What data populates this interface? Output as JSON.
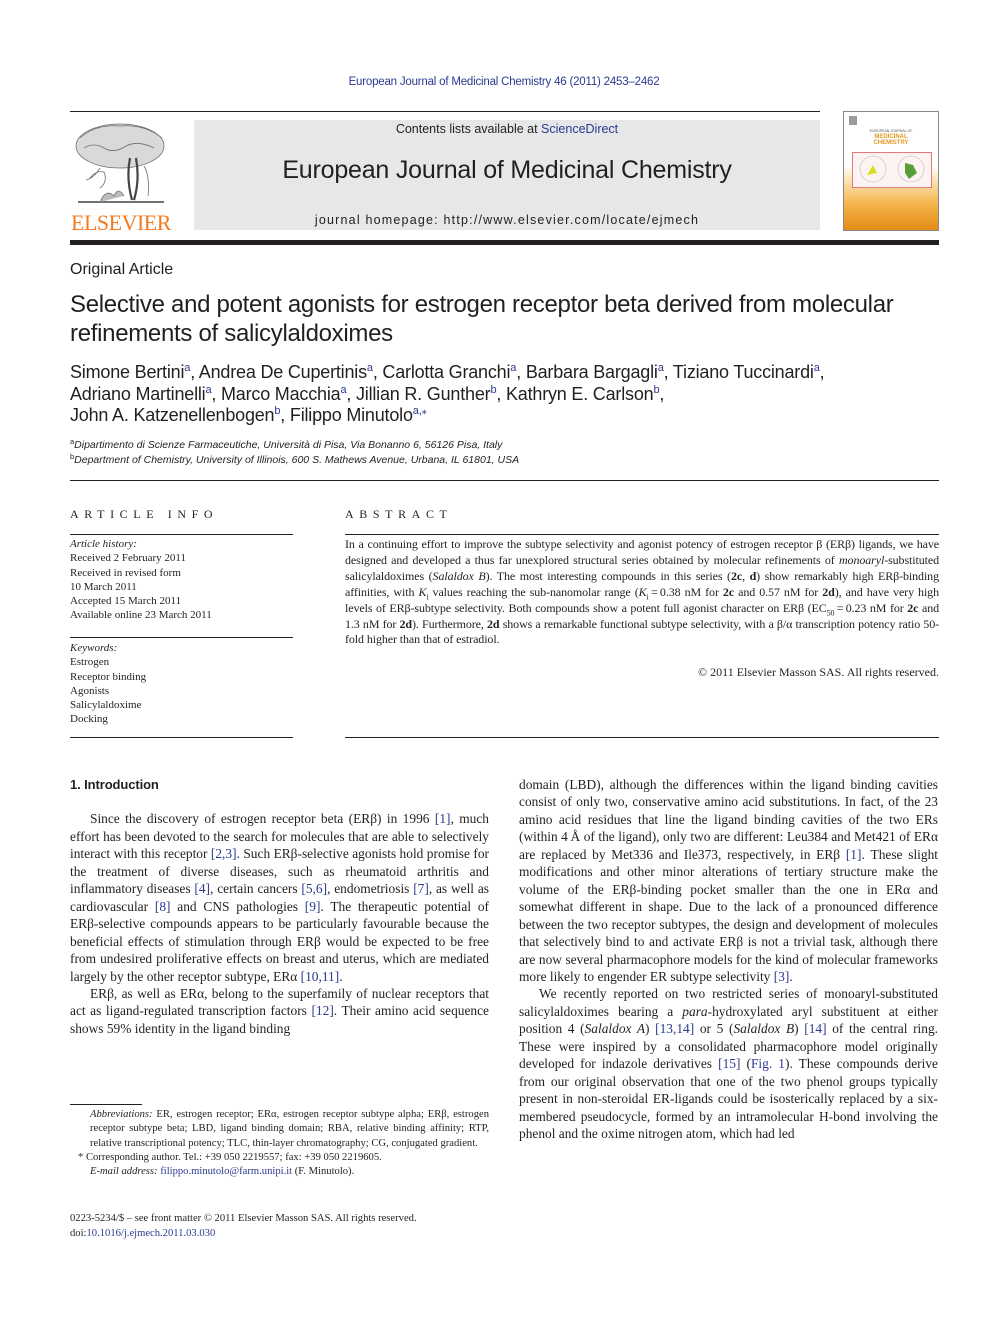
{
  "running_header": "European Journal of Medicinal Chemistry 46 (2011) 2453–2462",
  "masthead": {
    "publisher_logo": "ELSEVIER",
    "contents_prefix": "Contents lists available at ",
    "contents_link": "ScienceDirect",
    "journal_name": "European Journal of Medicinal Chemistry",
    "homepage_label": "journal homepage: ",
    "homepage_url": "http://www.elsevier.com/locate/ejmech",
    "cover_small": "EUROPEAN JOURNAL OF",
    "cover_title_1": "MEDICINAL",
    "cover_title_2": "CHEMISTRY"
  },
  "colors": {
    "link": "#2b3990",
    "elsevier_orange": "#f47920",
    "masthead_bg": "#e6e7e8"
  },
  "article": {
    "type": "Original Article",
    "title": "Selective and potent agonists for estrogen receptor beta derived from molecular refinements of salicylaldoximes",
    "authors": [
      {
        "name": "Simone Bertini",
        "aff": "a"
      },
      {
        "name": "Andrea De Cupertinis",
        "aff": "a"
      },
      {
        "name": "Carlotta Granchi",
        "aff": "a"
      },
      {
        "name": "Barbara Bargagli",
        "aff": "a"
      },
      {
        "name": "Tiziano Tuccinardi",
        "aff": "a",
        "br": true
      },
      {
        "name": "Adriano Martinelli",
        "aff": "a"
      },
      {
        "name": "Marco Macchia",
        "aff": "a"
      },
      {
        "name": "Jillian R. Gunther",
        "aff": "b"
      },
      {
        "name": "Kathryn E. Carlson",
        "aff": "b",
        "br": true
      },
      {
        "name": "John A. Katzenellenbogen",
        "aff": "b"
      },
      {
        "name": "Filippo Minutolo",
        "aff": "a,⁎",
        "last": true
      }
    ],
    "affiliations": [
      {
        "key": "a",
        "text": "Dipartimento di Scienze Farmaceutiche, Università di Pisa, Via Bonanno 6, 56126 Pisa, Italy"
      },
      {
        "key": "b",
        "text": "Department of Chemistry, University of Illinois, 600 S. Mathews Avenue, Urbana, IL 61801, USA"
      }
    ]
  },
  "article_info": {
    "heading": "ARTICLE INFO",
    "history_label": "Article history:",
    "history": [
      "Received 2 February 2011",
      "Received in revised form",
      "10 March 2011",
      "Accepted 15 March 2011",
      "Available online 23 March 2011"
    ],
    "keywords_label": "Keywords:",
    "keywords": [
      "Estrogen",
      "Receptor binding",
      "Agonists",
      "Salicylaldoxime",
      "Docking"
    ]
  },
  "abstract": {
    "heading": "ABSTRACT",
    "runs": [
      {
        "t": "In a continuing effort to improve the subtype selectivity and agonist potency of estrogen receptor β (ERβ) ligands, we have designed and developed a thus far unexplored structural series obtained by molecular refinements of "
      },
      {
        "t": "monoaryl",
        "s": "i"
      },
      {
        "t": "-substituted salicylaldoximes ("
      },
      {
        "t": "Salaldox B",
        "s": "i"
      },
      {
        "t": "). The most interesting compounds in this series ("
      },
      {
        "t": "2c",
        "s": "b"
      },
      {
        "t": ", "
      },
      {
        "t": "d",
        "s": "b"
      },
      {
        "t": ") show remarkably high ERβ-binding affinities, with "
      },
      {
        "t": "K",
        "s": "i"
      },
      {
        "t": "i",
        "s": "sub"
      },
      {
        "t": " values reaching the sub-nanomolar range ("
      },
      {
        "t": "K",
        "s": "i"
      },
      {
        "t": "i",
        "s": "sub"
      },
      {
        "t": " = 0.38 nM for "
      },
      {
        "t": "2c",
        "s": "b"
      },
      {
        "t": " and 0.57 nM for "
      },
      {
        "t": "2d",
        "s": "b"
      },
      {
        "t": "), and have very high levels of ERβ-subtype selectivity. Both compounds show a potent full agonist character on ERβ (EC"
      },
      {
        "t": "50",
        "s": "sub"
      },
      {
        "t": " = 0.23 nM for "
      },
      {
        "t": "2c",
        "s": "b"
      },
      {
        "t": " and 1.3 nM for "
      },
      {
        "t": "2d",
        "s": "b"
      },
      {
        "t": "). Furthermore, "
      },
      {
        "t": "2d",
        "s": "b"
      },
      {
        "t": " shows a remarkable functional subtype selectivity, with a β/α transcription potency ratio 50-fold higher than that of estradiol."
      }
    ],
    "copyright": "© 2011 Elsevier Masson SAS. All rights reserved."
  },
  "body": {
    "section_heading": "1.  Introduction",
    "left_paragraphs": [
      [
        {
          "t": "Since the discovery of estrogen receptor beta (ERβ) in 1996 "
        },
        {
          "t": "[1]",
          "s": "a"
        },
        {
          "t": ", much effort has been devoted to the search for molecules that are able to selectively interact with this receptor "
        },
        {
          "t": "[2,3]",
          "s": "a"
        },
        {
          "t": ". Such ERβ-selective agonists hold promise for the treatment of diverse diseases, such as rheumatoid arthritis and inflammatory diseases "
        },
        {
          "t": "[4]",
          "s": "a"
        },
        {
          "t": ", certain cancers "
        },
        {
          "t": "[5,6]",
          "s": "a"
        },
        {
          "t": ", endometriosis "
        },
        {
          "t": "[7]",
          "s": "a"
        },
        {
          "t": ", as well as cardiovascular "
        },
        {
          "t": "[8]",
          "s": "a"
        },
        {
          "t": " and CNS pathologies "
        },
        {
          "t": "[9]",
          "s": "a"
        },
        {
          "t": ". The therapeutic potential of ERβ-selective compounds appears to be particularly favourable because the beneficial effects of stimulation through ERβ would be expected to be free from undesired proliferative effects on breast and uterus, which are mediated largely by the other receptor subtype, ERα "
        },
        {
          "t": "[10,11]",
          "s": "a"
        },
        {
          "t": "."
        }
      ],
      [
        {
          "t": "ERβ, as well as ERα, belong to the superfamily of nuclear receptors that act as ligand-regulated transcription factors "
        },
        {
          "t": "[12]",
          "s": "a"
        },
        {
          "t": ". Their amino acid sequence shows 59% identity in the ligand binding"
        }
      ]
    ],
    "right_paragraphs": [
      [
        {
          "t": "domain (LBD), although the differences within the ligand binding cavities consist of only two, conservative amino acid substitutions. In fact, of the 23 amino acid residues that line the ligand binding cavities of the two ERs (within 4 Å of the ligand), only two are different: Leu384 and Met421 of ERα are replaced by Met336 and Ile373, respectively, in ERβ "
        },
        {
          "t": "[1]",
          "s": "a"
        },
        {
          "t": ". These slight modifications and other minor alterations of tertiary structure make the volume of the ERβ-binding pocket smaller than the one in ERα and somewhat different in shape. Due to the lack of a pronounced difference between the two receptor subtypes, the design and development of molecules that selectively bind to and activate ERβ is not a trivial task, although there are now several pharmacophore models for the kind of molecular frameworks more likely to engender ER subtype selectivity "
        },
        {
          "t": "[3]",
          "s": "a"
        },
        {
          "t": "."
        }
      ],
      [
        {
          "t": "We recently reported on two restricted series of monoaryl-substituted salicylaldoximes bearing a "
        },
        {
          "t": "para",
          "s": "i"
        },
        {
          "t": "-hydroxylated aryl substituent at either position 4 ("
        },
        {
          "t": "Salaldox A",
          "s": "i"
        },
        {
          "t": ") "
        },
        {
          "t": "[13,14]",
          "s": "a"
        },
        {
          "t": " or 5 ("
        },
        {
          "t": "Salaldox B",
          "s": "i"
        },
        {
          "t": ") "
        },
        {
          "t": "[14]",
          "s": "a"
        },
        {
          "t": " of the central ring. These were inspired by a consolidated pharmacophore model originally developed for indazole derivatives "
        },
        {
          "t": "[15]",
          "s": "a"
        },
        {
          "t": " ("
        },
        {
          "t": "Fig. 1",
          "s": "a"
        },
        {
          "t": "). These compounds derive from our original observation that one of the two phenol groups typically present in non-steroidal ER-ligands could be isosterically replaced by a six-membered pseudocycle, formed by an intramolecular H-bond involving the phenol and the oxime nitrogen atom, which had led"
        }
      ]
    ]
  },
  "footnotes": {
    "abbreviations": [
      {
        "t": "Abbreviations:",
        "s": "i"
      },
      {
        "t": " ER, estrogen receptor; ERα, estrogen receptor subtype alpha; ERβ, estrogen receptor subtype beta; LBD, ligand binding domain; RBA, relative binding affinity; RTP, relative transcriptional potency; TLC, thin-layer chromatography; CG, conjugated gradient."
      }
    ],
    "corresponding": "*  Corresponding author. Tel.: +39 050 2219557; fax: +39 050 2219605.",
    "email_label": "E-mail address:",
    "email": "filippo.minutolo@farm.unipi.it",
    "email_suffix": " (F. Minutolo).",
    "front_matter": "0223-5234/$ – see front matter © 2011 Elsevier Masson SAS. All rights reserved.",
    "doi_label": "doi:",
    "doi": "10.1016/j.ejmech.2011.03.030"
  }
}
